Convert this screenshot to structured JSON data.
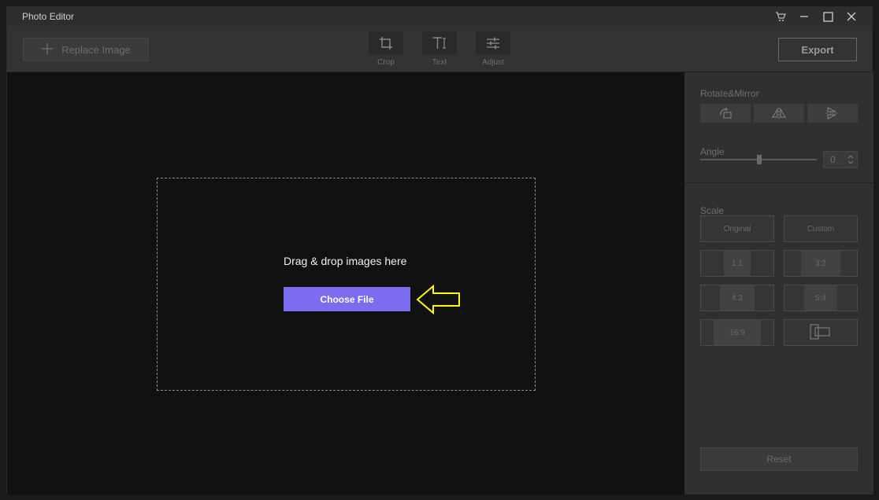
{
  "window": {
    "title": "Photo Editor"
  },
  "titlebar_icons": [
    "cart-icon",
    "minimize-icon",
    "maximize-icon",
    "close-icon"
  ],
  "toolbar": {
    "replace_label": "Replace Image",
    "tools": [
      {
        "label": "Crop",
        "icon": "crop-icon"
      },
      {
        "label": "Text",
        "icon": "text-icon"
      },
      {
        "label": "Adjust",
        "icon": "adjust-sliders-icon"
      }
    ],
    "export_label": "Export"
  },
  "canvas": {
    "drop_text": "Drag & drop images here",
    "choose_label": "Choose File",
    "accent_color": "#7b6cf0",
    "arrow_color": "#ffff00"
  },
  "panel": {
    "rotate_label": "Rotate&Mirror",
    "angle_label": "Angle",
    "angle_value": "0",
    "scale_label": "Scale",
    "scale_options": [
      "Original",
      "Custom",
      "1:1",
      "3:2",
      "4:3",
      "5:4",
      "16:9"
    ],
    "reset_label": "Reset"
  }
}
